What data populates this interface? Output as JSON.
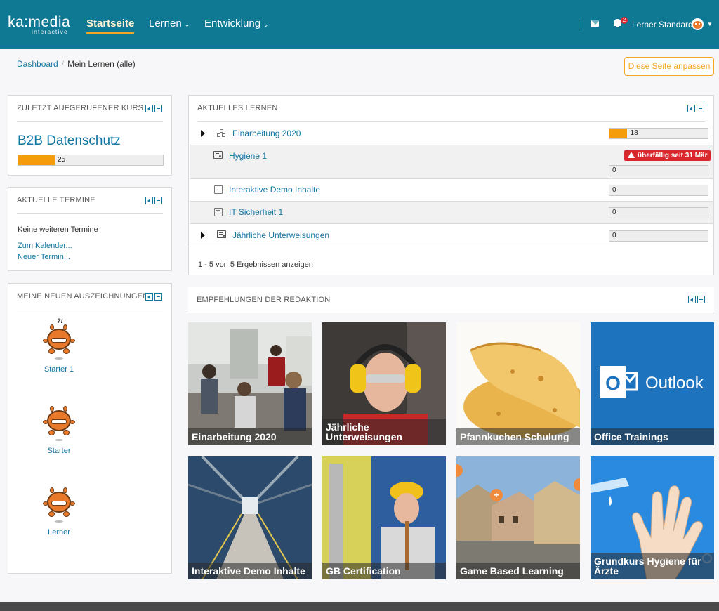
{
  "brand": {
    "logo_main": "ka:media",
    "logo_sub": "interactive"
  },
  "nav": {
    "items": [
      {
        "label": "Startseite",
        "active": true
      },
      {
        "label": "Lernen",
        "dropdown": true
      },
      {
        "label": "Entwicklung",
        "dropdown": true
      }
    ],
    "notifications_count": "2",
    "user_name": "Lerner Standard"
  },
  "breadcrumb": {
    "home": "Dashboard",
    "current": "Mein Lernen (alle)"
  },
  "customize_button": "Diese Seite anpassen",
  "recent_course": {
    "header": "ZULETZT AUFGERUFENER KURS",
    "title": "B2B Datenschutz",
    "progress": 25
  },
  "appointments": {
    "header": "AKTUELLE TERMINE",
    "empty_text": "Keine weiteren Termine",
    "calendar_link": "Zum Kalender...",
    "new_link": "Neuer Termin..."
  },
  "awards": {
    "header": "MEINE NEUEN AUSZEICHNUNGEN",
    "items": [
      {
        "label": "Starter 1"
      },
      {
        "label": "Starter"
      },
      {
        "label": "Lerner"
      }
    ]
  },
  "current_learning": {
    "header": "AKTUELLES LERNEN",
    "rows": [
      {
        "title": "Einarbeitung 2020",
        "progress": 18,
        "expandable": true,
        "icon": "program-icon"
      },
      {
        "title": "Hygiene 1",
        "progress": 0,
        "icon": "course-icon",
        "overdue": "überfällig seit 31 Mär"
      },
      {
        "title": "Interaktive Demo Inhalte",
        "progress": 0,
        "icon": "cube-icon"
      },
      {
        "title": "IT Sicherheit 1",
        "progress": 0,
        "icon": "cube-icon"
      },
      {
        "title": "Jährliche Unterweisungen",
        "progress": 0,
        "expandable": true,
        "icon": "course-icon"
      }
    ],
    "footer": "1 - 5 von 5 Ergebnissen anzeigen"
  },
  "recommendations": {
    "header": "EMPFEHLUNGEN DER REDAKTION",
    "tiles": [
      {
        "caption": "Einarbeitung 2020"
      },
      {
        "caption": "Jährliche Unterweisungen"
      },
      {
        "caption": "Pfannkuchen Schulung"
      },
      {
        "caption": "Office Trainings",
        "logo_text": "Outlook"
      },
      {
        "caption": "Interaktive Demo Inhalte"
      },
      {
        "caption": "GB Certification"
      },
      {
        "caption": "Game Based Learning"
      },
      {
        "caption": "Grundkurs Hygiene für Ärzte"
      }
    ]
  },
  "colors": {
    "navbar": "#0f7893",
    "accent": "#f5a623",
    "link": "#1176a0",
    "overdue": "#d9272e",
    "progress": "#f59c0b"
  }
}
